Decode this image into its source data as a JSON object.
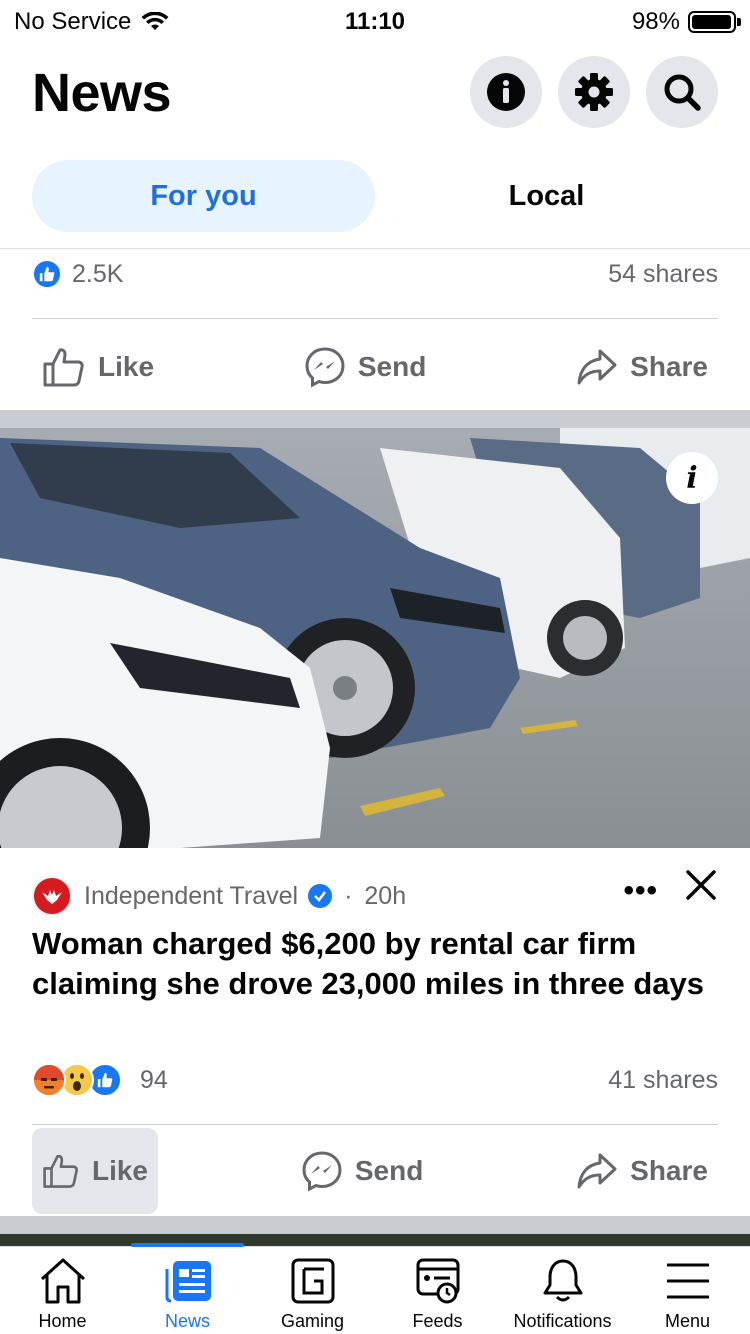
{
  "status_bar": {
    "carrier": "No Service",
    "time": "11:10",
    "battery": "98%",
    "battery_level": 0.98
  },
  "header": {
    "title": "News",
    "buttons": [
      "info-icon",
      "gear-icon",
      "search-icon"
    ]
  },
  "tabs": [
    {
      "label": "For you",
      "active": true
    },
    {
      "label": "Local",
      "active": false
    }
  ],
  "post_previous": {
    "reaction_count": "2.5K",
    "shares": "54 shares",
    "actions": {
      "like": "Like",
      "send": "Send",
      "share": "Share"
    }
  },
  "post_current": {
    "image_info_badge": "i",
    "source": "Independent Travel",
    "verified": true,
    "separator": "·",
    "age": "20h",
    "headline": "Woman charged $6,200 by rental car firm claiming she drove 23,000 miles in three days",
    "reactions": [
      "angry",
      "wow",
      "like"
    ],
    "reaction_count": "94",
    "shares": "41 shares",
    "actions": {
      "like": "Like",
      "send": "Send",
      "share": "Share"
    },
    "menu_glyph": "•••"
  },
  "bottom_nav": [
    {
      "label": "Home",
      "icon": "home-icon",
      "active": false
    },
    {
      "label": "News",
      "icon": "news-icon",
      "active": true
    },
    {
      "label": "Gaming",
      "icon": "gaming-icon",
      "active": false
    },
    {
      "label": "Feeds",
      "icon": "feeds-icon",
      "active": false
    },
    {
      "label": "Notifications",
      "icon": "bell-icon",
      "active": false
    },
    {
      "label": "Menu",
      "icon": "menu-icon",
      "active": false
    }
  ],
  "colors": {
    "brand_blue": "#1877f2",
    "tab_active_bg": "#e7f3ff",
    "muted_text": "#65676b",
    "separator": "#c9ccd1"
  }
}
